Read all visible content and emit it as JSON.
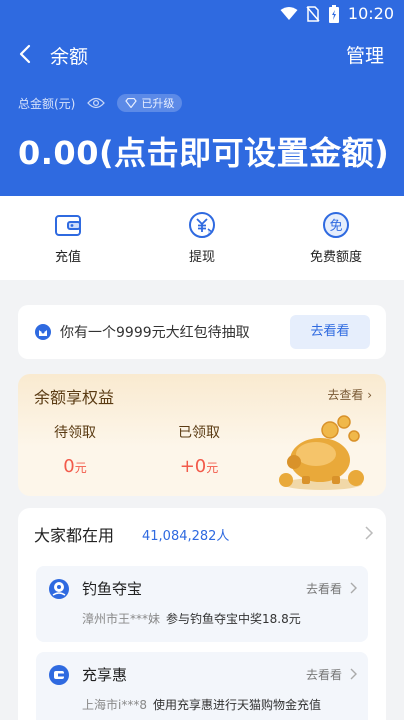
{
  "status_bar": {
    "time": "10:20"
  },
  "header": {
    "title": "余额",
    "manage_label": "管理",
    "total_label": "总金额(元)",
    "upgrade_badge": "已升级",
    "amount_text": "0.00(点击即可设置金额)"
  },
  "actions": [
    {
      "label": "充值",
      "icon": "wallet-icon"
    },
    {
      "label": "提现",
      "icon": "withdraw-icon"
    },
    {
      "label": "免费额度",
      "icon": "free-quota-icon"
    }
  ],
  "notice": {
    "text": "你有一个9999元大红包待抽取",
    "button": "去看看"
  },
  "benefit": {
    "title": "余额享权益",
    "link": "去查看",
    "pending_label": "待领取",
    "pending_value": "0",
    "pending_unit": "元",
    "received_label": "已领取",
    "received_value": "+0",
    "received_unit": "元"
  },
  "popular": {
    "title": "大家都在用",
    "count": "41,084,282人",
    "items": [
      {
        "name": "钓鱼夺宝",
        "link": "去看看",
        "user": "漳州市王***妹",
        "desc": "参与钓鱼夺宝中奖18.8元"
      },
      {
        "name": "充享惠",
        "link": "去看看",
        "user": "上海市i***8",
        "desc": "使用充享惠进行天猫购物金充值"
      }
    ]
  },
  "colors": {
    "primary": "#2f6ae0",
    "accent_red": "#f25a4a",
    "gold": "#e9a93a"
  }
}
